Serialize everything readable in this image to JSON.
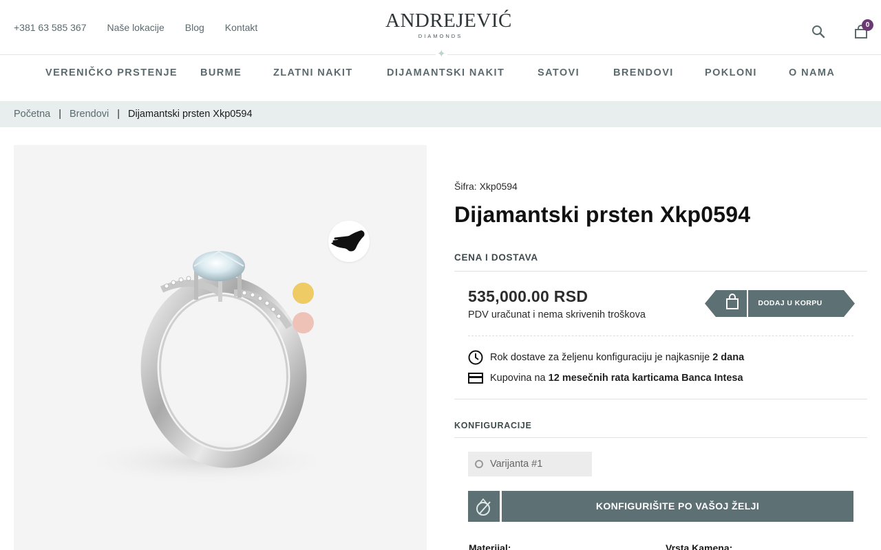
{
  "top": {
    "phone": "+381 63 585 367",
    "links": [
      "Naše lokacije",
      "Blog",
      "Kontakt"
    ],
    "logo_text": "ANDREJEVIĆ",
    "logo_sub": "DIAMONDS",
    "cart_count": "0"
  },
  "nav": {
    "items": [
      "VERENIČKO PRSTENJE",
      "BURME",
      "ZLATNI NAKIT",
      "DIJAMANTSKI NAKIT",
      "SATOVI",
      "BRENDOVI",
      "POKLONI",
      "O NAMA"
    ]
  },
  "breadcrumb": {
    "home": "Početna",
    "sep": "|",
    "category": "Brendovi",
    "current": "Dijamantski prsten Xkp0594"
  },
  "product": {
    "sku": "Šifra: Xkp0594",
    "title": "Dijamantski prsten Xkp0594",
    "price_heading": "CENA I DOSTAVA",
    "price": "535,000.00 RSD",
    "price_note": "PDV uračunat i nema skrivenih troškova",
    "add_to_cart": "DODAJ U KORPU",
    "delivery_text": "Rok dostave za željenu konfiguraciju je najkasnije",
    "delivery_days": "2 dana",
    "installments_prefix": "Kupovina na",
    "installments_bold": "12 mesečnih rata karticama Banca Intesa",
    "config_heading": "KONFIGURACIJE",
    "variant": "Varijanta #1",
    "config_button": "KONFIGURIŠITE PO VAŠOJ ŽELJI",
    "spec_material": "Materijal:",
    "spec_stone": "Vrsta Kamena:"
  },
  "colors": {
    "accent": "#5d7175",
    "badge": "#6b3a74",
    "gold_swatch": "#efcb65",
    "rose_swatch": "#efc2b8"
  }
}
